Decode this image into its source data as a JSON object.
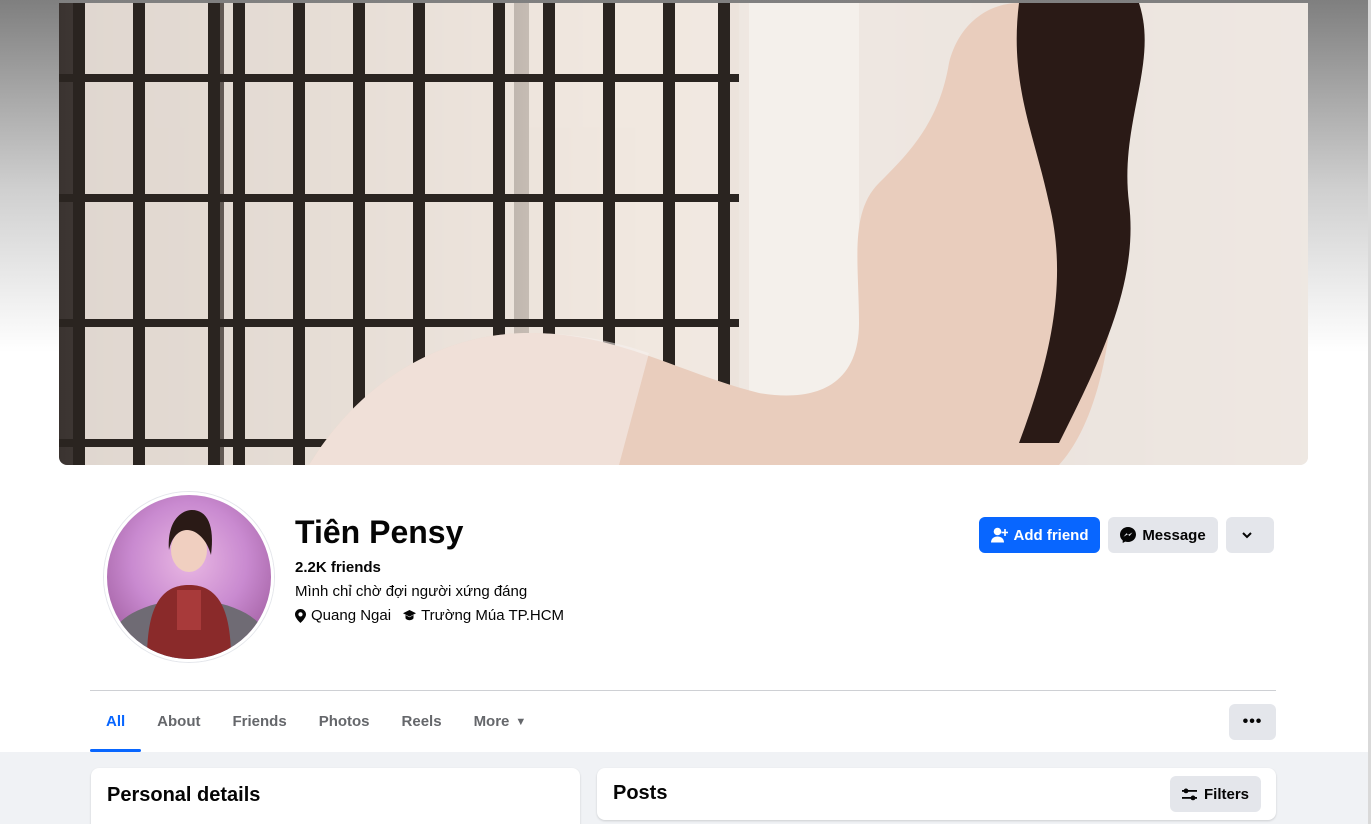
{
  "profile": {
    "name": "Tiên Pensy",
    "friends": "2.2K friends",
    "bio": "Mình chỉ chờ đợi người xứng đáng",
    "location": "Quang Ngai",
    "education": "Trường Múa TP.HCM"
  },
  "actions": {
    "add_friend": "Add friend",
    "message": "Message",
    "dropdown_icon": "chevron-down-icon"
  },
  "tabs": [
    {
      "label": "All",
      "active": true
    },
    {
      "label": "About"
    },
    {
      "label": "Friends"
    },
    {
      "label": "Photos"
    },
    {
      "label": "Reels"
    },
    {
      "label": "More"
    }
  ],
  "tabs_more_icon": "ellipsis-icon",
  "sections": {
    "personal_details": "Personal details",
    "posts": "Posts",
    "filters": "Filters"
  },
  "colors": {
    "accent": "#0866ff",
    "button_gray": "#e4e6eb",
    "page_bg": "#f0f2f5",
    "text_secondary": "#65676b"
  }
}
